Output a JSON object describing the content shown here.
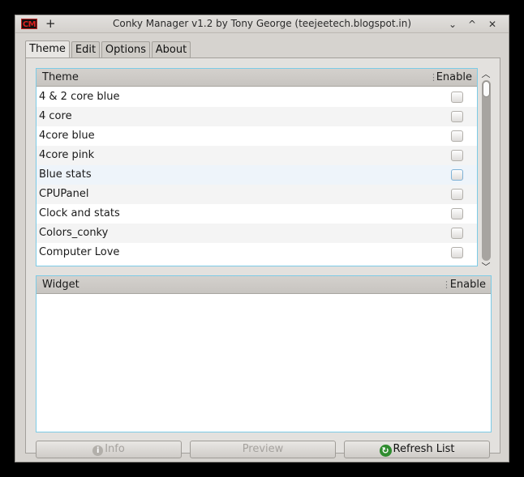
{
  "window": {
    "title": "Conky Manager v1.2 by Tony George (teejeetech.blogspot.in)",
    "app_icon_text": "CM",
    "pin_glyph": "+",
    "min_glyph": "⌄",
    "max_glyph": "^",
    "close_glyph": "✕"
  },
  "tabs": [
    {
      "label": "Theme"
    },
    {
      "label": "Edit"
    },
    {
      "label": "Options"
    },
    {
      "label": "About"
    }
  ],
  "theme_list": {
    "col_name": "Theme",
    "col_enable": "Enable",
    "rows": [
      {
        "label": "4 & 2 core blue",
        "enabled": false
      },
      {
        "label": "4 core",
        "enabled": false
      },
      {
        "label": "4core blue",
        "enabled": false
      },
      {
        "label": "4core pink",
        "enabled": false
      },
      {
        "label": "Blue stats",
        "enabled": false
      },
      {
        "label": "CPUPanel",
        "enabled": false
      },
      {
        "label": "Clock and stats",
        "enabled": false
      },
      {
        "label": "Colors_conky",
        "enabled": false
      },
      {
        "label": "Computer Love",
        "enabled": false
      }
    ]
  },
  "widget_list": {
    "col_name": "Widget",
    "col_enable": "Enable",
    "rows": []
  },
  "buttons": {
    "info": "Info",
    "preview": "Preview",
    "refresh": "Refresh List"
  },
  "colors": {
    "list_border": "#7ccbe6",
    "refresh_icon": "#2f8c2f"
  }
}
